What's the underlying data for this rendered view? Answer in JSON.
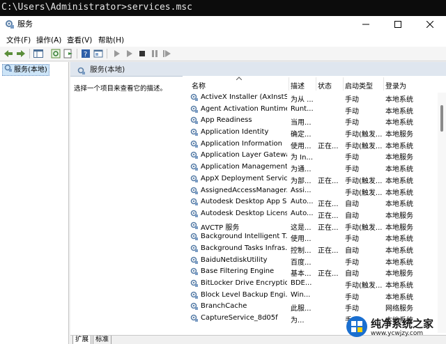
{
  "console": {
    "prompt": "C:\\Users\\Administrator>services.msc"
  },
  "window": {
    "title": "服务"
  },
  "menu": [
    "文件(F)",
    "操作(A)",
    "查看(V)",
    "帮助(H)"
  ],
  "tree": {
    "item": "服务(本地)"
  },
  "pane": {
    "header": "服务(本地)",
    "description": "选择一个项目来查看它的描述。"
  },
  "columns": {
    "name": "名称",
    "desc": "描述",
    "status": "状态",
    "startup": "启动类型",
    "logon": "登录为"
  },
  "services": [
    {
      "name": "ActiveX Installer (AxInstSV)",
      "desc": "为从 ...",
      "status": "",
      "startup": "手动",
      "logon": "本地系统"
    },
    {
      "name": "Agent Activation Runtime...",
      "desc": "Runt...",
      "status": "",
      "startup": "手动",
      "logon": "本地系统"
    },
    {
      "name": "App Readiness",
      "desc": "当用...",
      "status": "",
      "startup": "手动",
      "logon": "本地系统"
    },
    {
      "name": "Application Identity",
      "desc": "确定...",
      "status": "",
      "startup": "手动(触发...",
      "logon": "本地服务"
    },
    {
      "name": "Application Information",
      "desc": "使用...",
      "status": "正在...",
      "startup": "手动(触发...",
      "logon": "本地系统"
    },
    {
      "name": "Application Layer Gatewa...",
      "desc": "为 In...",
      "status": "",
      "startup": "手动",
      "logon": "本地服务"
    },
    {
      "name": "Application Management",
      "desc": "为通...",
      "status": "",
      "startup": "手动",
      "logon": "本地系统"
    },
    {
      "name": "AppX Deployment Servic...",
      "desc": "为部...",
      "status": "正在...",
      "startup": "手动(触发...",
      "logon": "本地系统"
    },
    {
      "name": "AssignedAccessManager...",
      "desc": "Assi...",
      "status": "",
      "startup": "手动(触发...",
      "logon": "本地系统"
    },
    {
      "name": "Autodesk Desktop App S...",
      "desc": "Auto...",
      "status": "正在...",
      "startup": "自动",
      "logon": "本地系统"
    },
    {
      "name": "Autodesk Desktop Licens...",
      "desc": "Auto...",
      "status": "正在...",
      "startup": "自动",
      "logon": "本地服务"
    },
    {
      "name": "AVCTP 服务",
      "desc": "这是...",
      "status": "正在...",
      "startup": "手动(触发...",
      "logon": "本地服务"
    },
    {
      "name": "Background Intelligent T...",
      "desc": "使用...",
      "status": "",
      "startup": "手动",
      "logon": "本地系统"
    },
    {
      "name": "Background Tasks Infras...",
      "desc": "控制...",
      "status": "正在...",
      "startup": "自动",
      "logon": "本地系统"
    },
    {
      "name": "BaiduNetdiskUtility",
      "desc": "百度...",
      "status": "",
      "startup": "手动",
      "logon": "本地系统"
    },
    {
      "name": "Base Filtering Engine",
      "desc": "基本...",
      "status": "正在...",
      "startup": "自动",
      "logon": "本地服务"
    },
    {
      "name": "BitLocker Drive Encryptio...",
      "desc": "BDE...",
      "status": "",
      "startup": "手动(触发...",
      "logon": "本地系统"
    },
    {
      "name": "Block Level Backup Engi...",
      "desc": "Win...",
      "status": "",
      "startup": "手动",
      "logon": "本地系统"
    },
    {
      "name": "BranchCache",
      "desc": "此服...",
      "status": "",
      "startup": "手动",
      "logon": "网络服务"
    },
    {
      "name": "CaptureService_8d05f",
      "desc": "为...",
      "status": "",
      "startup": "手动",
      "logon": "本地系统"
    }
  ],
  "tabs": [
    "扩展",
    "标准"
  ],
  "watermark": {
    "brand": "纯净系统之家",
    "url": "www.ycwjzy.com"
  },
  "colors": {
    "accent": "#0078d7",
    "header_bg": "#dfe6ef"
  }
}
